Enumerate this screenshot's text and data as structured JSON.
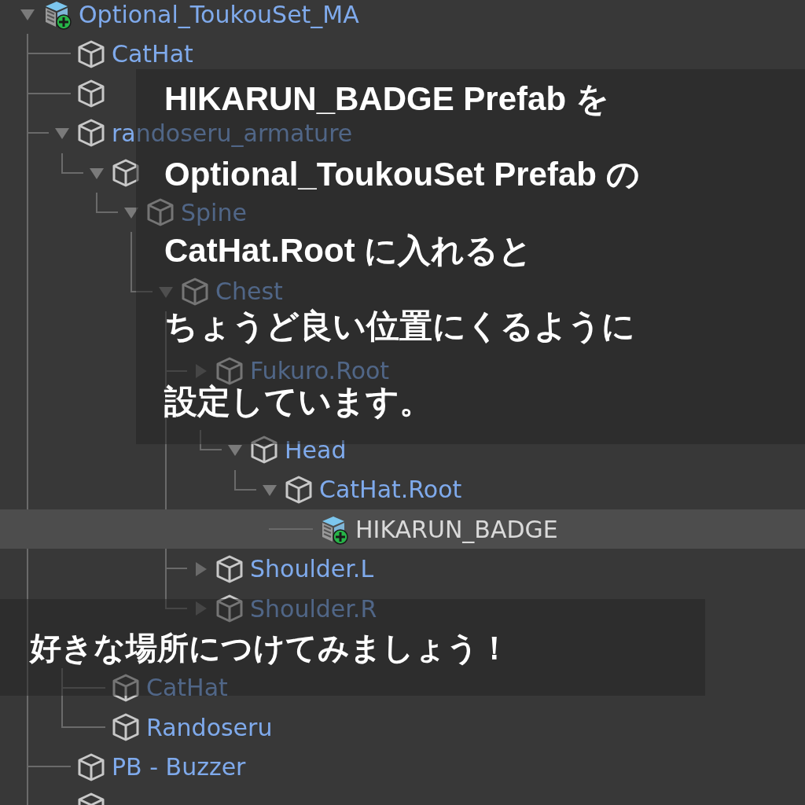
{
  "hierarchy": {
    "items": [
      {
        "label": "Optional_ToukouSet_MA",
        "kind": "prefab",
        "expanded": true,
        "selected": false,
        "children": [
          {
            "label": "CatHat",
            "kind": "object",
            "selected": false
          },
          {
            "kind": "object",
            "selected": false
          },
          {
            "label": "randoseru_armature",
            "kind": "object",
            "expanded": true,
            "selected": false,
            "children": [
              {
                "kind": "object",
                "expanded": true,
                "selected": false,
                "children": [
                  {
                    "label": "Spine",
                    "kind": "object",
                    "expanded": true,
                    "selected": false,
                    "children": [
                      {
                        "selected": false
                      },
                      {
                        "label": "Chest",
                        "kind": "object",
                        "expanded": true,
                        "selected": false,
                        "children": [
                          {
                            "selected": false
                          },
                          {
                            "label": "Fukuro.Root",
                            "kind": "object",
                            "expanded": false,
                            "selected": false
                          },
                          {
                            "selected": false,
                            "children": [
                              {
                                "label": "Head",
                                "kind": "object",
                                "expanded": true,
                                "selected": false,
                                "children": [
                                  {
                                    "label": "CatHat.Root",
                                    "kind": "object",
                                    "expanded": true,
                                    "selected": false,
                                    "children": [
                                      {
                                        "label": "HIKARUN_BADGE",
                                        "kind": "prefab",
                                        "selected": true
                                      }
                                    ]
                                  }
                                ]
                              }
                            ]
                          },
                          {
                            "label": "Shoulder.L",
                            "kind": "object",
                            "expanded": false,
                            "selected": false
                          },
                          {
                            "label": "Shoulder.R",
                            "kind": "object",
                            "expanded": false,
                            "selected": false
                          }
                        ]
                      }
                    ]
                  }
                ]
              }
            ]
          },
          {
            "selected": false,
            "children": [
              {
                "label": "CatHat",
                "kind": "object",
                "selected": false
              },
              {
                "label": "Randoseru",
                "kind": "object",
                "selected": false
              }
            ]
          },
          {
            "label": "PB - Buzzer",
            "kind": "object",
            "selected": false
          },
          {
            "kind": "object",
            "selected": false
          }
        ]
      }
    ]
  },
  "captions": [
    {
      "lines": [
        "HIKARUN_BADGE Prefab を",
        "Optional_ToukouSet Prefab の",
        "CatHat.Root に入れると",
        "ちょうど良い位置にくるように",
        "設定しています。"
      ]
    },
    {
      "lines": [
        "好きな場所につけてみましょう！"
      ]
    }
  ]
}
